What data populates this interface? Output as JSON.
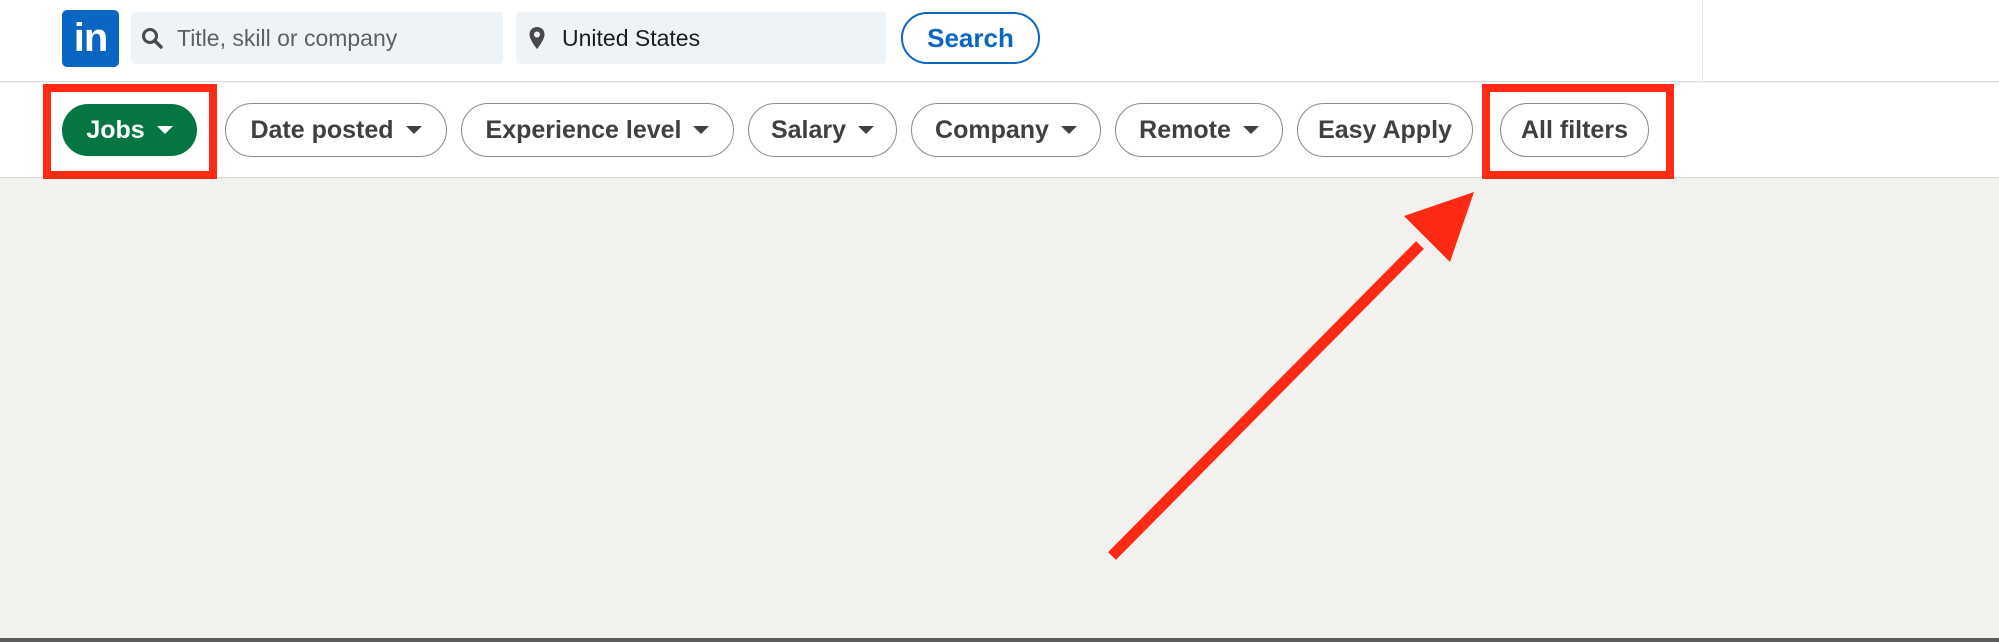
{
  "header": {
    "logo_text": "in",
    "search": {
      "placeholder": "Title, skill or company",
      "value": ""
    },
    "location": {
      "value": "United States"
    },
    "search_button_label": "Search"
  },
  "filters": {
    "jobs_label": "Jobs",
    "date_posted_label": "Date posted",
    "experience_level_label": "Experience level",
    "salary_label": "Salary",
    "company_label": "Company",
    "remote_label": "Remote",
    "easy_apply_label": "Easy Apply",
    "all_filters_label": "All filters"
  },
  "annotations": {
    "highlight_color": "#ff2a16",
    "highlighted": [
      "jobs-button",
      "all-filters-button"
    ],
    "arrow_points_to": "all-filters-button"
  },
  "colors": {
    "brand_blue": "#0a66c2",
    "jobs_green": "#057642",
    "background": "#f3f2ef"
  }
}
